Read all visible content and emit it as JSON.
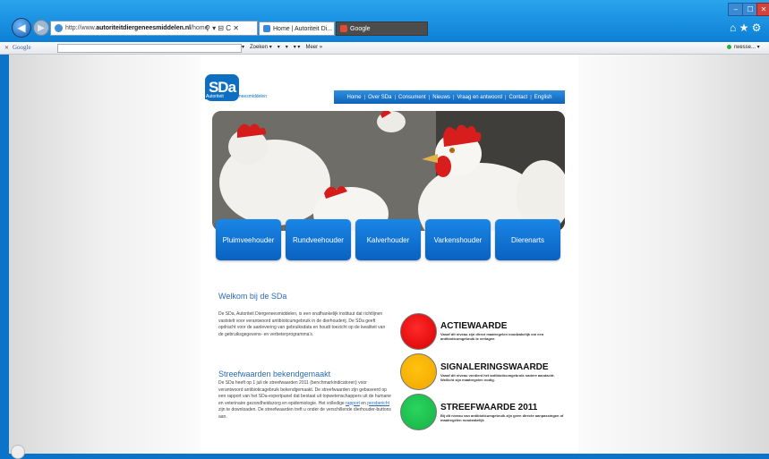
{
  "browser": {
    "url_prefix": "http://www.",
    "url_host": "autoriteitdiergeneesmiddelen.nl",
    "url_path": "/home",
    "address_tools": "⚲ ▾ ⊟ C ✕",
    "tabs": [
      {
        "label": "Home | Autoriteit Di... ✕"
      },
      {
        "label": "Google"
      }
    ],
    "window_controls": {
      "minimize": "–",
      "maximize": "☐",
      "close": "✕"
    },
    "right_tools": "⌂ ★ ⚙"
  },
  "google_toolbar": {
    "close": "✕",
    "label": "Google",
    "items": [
      "▾",
      "Zoeken ▾",
      "▾",
      "▾",
      "▾ ▾",
      "Meer »"
    ],
    "right_text": "rwesse... ▾"
  },
  "site": {
    "logo_text": "SDa",
    "logo_sub_highlight": "Autoriteit",
    "logo_sub_rest": " Diergeneesmiddelen",
    "nav": [
      "Home",
      "Over SDa",
      "Consument",
      "Nieuws",
      "Vraag en antwoord",
      "Contact",
      "English"
    ],
    "categories": [
      "Pluimveehouder",
      "Rundveehouder",
      "Kalverhouder",
      "Varkenshouder",
      "Dierenarts"
    ],
    "welkom_title": "Welkom bij de SDa",
    "welkom_text": "De SDa, Autoriteit Diergeneesmiddelen, is een onafhankelijk instituut dat richtlijnen vaststelt voor verantwoord antibioticumgebruik in de dierhouderij. De SDa geeft opdracht voor de aanlevering van gebruiksdata en houdt toezicht op de kwaliteit van de gebruiksgegevens- en verbeterprogramma's.",
    "streef_title": "Streefwaarden bekendgemaakt",
    "streef_text_1": "De SDa heeft op 1 juli de streefwaarden 2011 (benchmarkindicatoren) voor verantwoord antibioticagebruik bekendgemaakt. De streefwaarden zijn gebaseerd op een rapport van het SDa-expertpanel dat bestaat uit topwetenschappers uit de humane en veterinaire gezondheidszorg en epidemiologie. Het volledige ",
    "streef_link_1": "rapport",
    "streef_text_2": " en ",
    "streef_link_2": "persbericht",
    "streef_text_3": " zijn te downloaden. De streefwaarden treft u onder de verschillende dierhouder-buttons aan.",
    "levels": [
      {
        "title": "ACTIEWAARDE",
        "desc": "Vanaf dit niveau zijn direct maatregelen noodzakelijk om een antibioticumgebruik te verlagen",
        "color": "#e00000"
      },
      {
        "title": "SIGNALERINGSWAARDE",
        "desc": "Vanaf dit niveau verdient het antibioticumgebruik nadere aandacht. Wellicht zijn maatregelen nodig.",
        "color": "#f7b400"
      },
      {
        "title": "STREEFWAARDE 2011",
        "desc": "Bij dit niveau van antibioticumgebruik zijn geen directe aanpassingen of maatregelen noodzakelijk",
        "color": "#1ec050"
      }
    ]
  }
}
